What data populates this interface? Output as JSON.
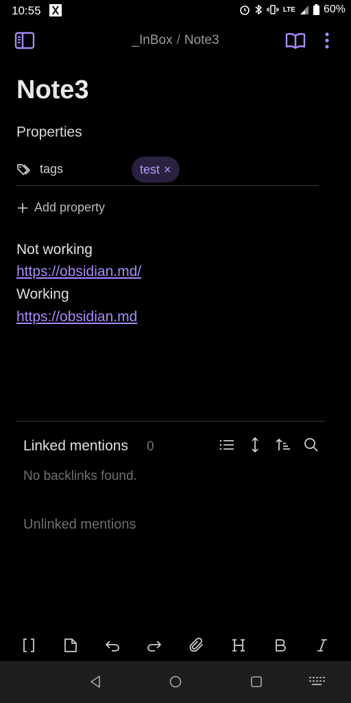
{
  "status_bar": {
    "time": "10:55",
    "battery": "60%",
    "network": "LTE"
  },
  "header": {
    "breadcrumb_folder": "_InBox",
    "breadcrumb_separator": "/",
    "breadcrumb_note": "Note3"
  },
  "note": {
    "title": "Note3",
    "properties_heading": "Properties",
    "property": {
      "key": "tags",
      "tag_value": "test",
      "remove_glyph": "×"
    },
    "add_property_label": "Add property",
    "lines": [
      {
        "text": "Not working"
      },
      {
        "link": "https://obsidian.md/"
      },
      {
        "text": "Working"
      },
      {
        "link": "https://obsidian.md"
      }
    ]
  },
  "backlinks": {
    "linked_title": "Linked mentions",
    "linked_count": "0",
    "empty_message": "No backlinks found.",
    "unlinked_title": "Unlinked mentions"
  },
  "toolbar_icons": [
    "link-brackets-icon",
    "file-icon",
    "undo-icon",
    "redo-icon",
    "attachment-icon",
    "heading-icon",
    "bold-icon",
    "italic-icon"
  ],
  "colors": {
    "accent": "#a88bfa",
    "tag_bg": "#2a2040",
    "background": "#000000"
  }
}
